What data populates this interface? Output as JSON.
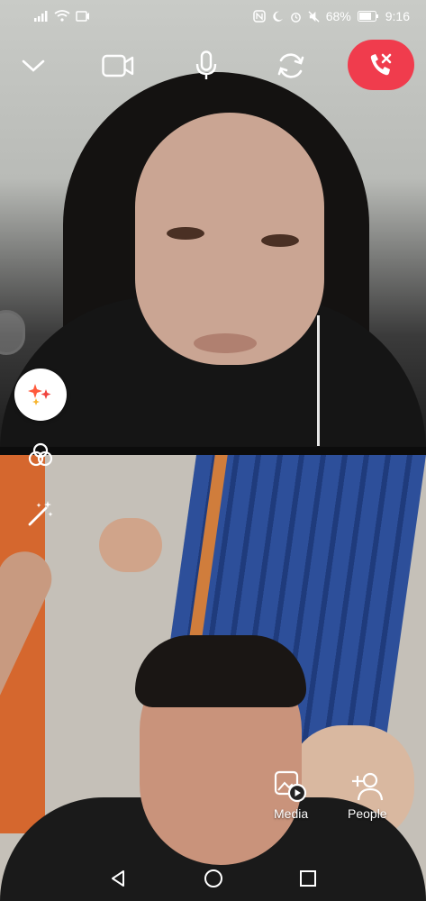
{
  "status_bar": {
    "battery_percent": "68%",
    "time": "9:16"
  },
  "call_controls": {
    "minimize_icon": "chevron-down-icon",
    "video_icon": "video-camera-icon",
    "mic_icon": "microphone-icon",
    "flip_icon": "flip-camera-icon",
    "end_call_icon": "end-call-icon",
    "end_call_color": "#f03c4d"
  },
  "side_tools": {
    "effects_icon": "sparkles-icon",
    "filters_icon": "filters-icon",
    "magic_icon": "magic-wand-icon"
  },
  "actions": {
    "media_label": "Media",
    "people_label": "People"
  },
  "nav_bar": {
    "back_icon": "back-triangle-icon",
    "home_icon": "home-circle-icon",
    "recents_icon": "recents-square-icon"
  }
}
